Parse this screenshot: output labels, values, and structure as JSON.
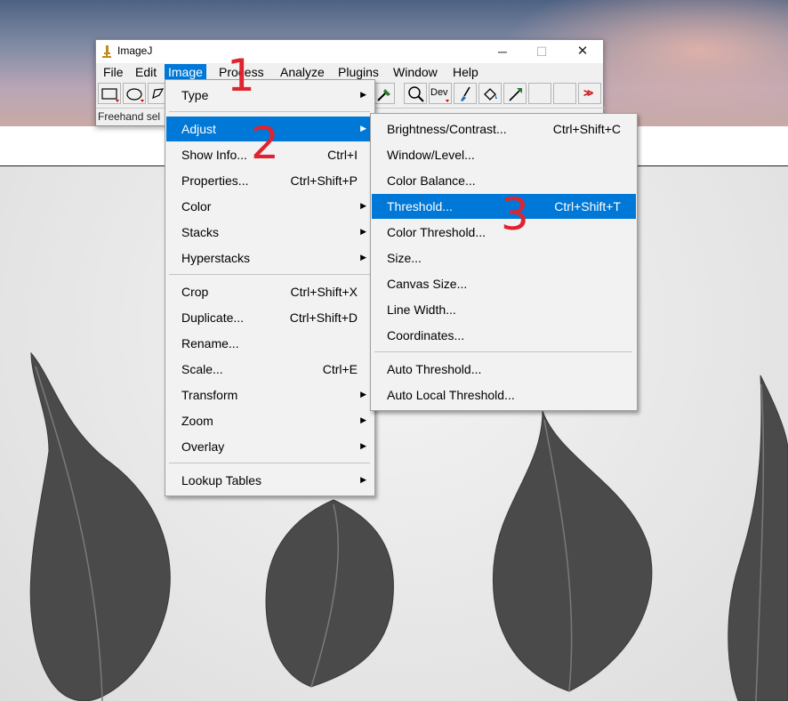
{
  "window": {
    "title": "ImageJ",
    "controls": {
      "minimize": "─",
      "maximize": "☐",
      "close": "✕"
    }
  },
  "menubar": [
    "File",
    "Edit",
    "Image",
    "Process",
    "Analyze",
    "Plugins",
    "Window",
    "Help"
  ],
  "toolbar": {
    "dev_label": "Dev",
    "more_label": "≫",
    "tools": [
      "rectangle-tool",
      "oval-tool",
      "polygon-tool",
      "color-picker-tool",
      "magnifier-tool",
      "dev-tool",
      "brush-tool",
      "flood-fill-tool",
      "arrow-tool",
      "empty-slot",
      "empty-slot",
      "more-tools"
    ]
  },
  "status": "Freehand sel",
  "image_menu": {
    "items": [
      {
        "label": "Type",
        "shortcut": "",
        "submenu": true
      },
      {
        "label": "Adjust",
        "shortcut": "",
        "submenu": true
      },
      {
        "label": "Show Info...",
        "shortcut": "Ctrl+I",
        "submenu": false
      },
      {
        "label": "Properties...",
        "shortcut": "Ctrl+Shift+P",
        "submenu": false
      },
      {
        "label": "Color",
        "shortcut": "",
        "submenu": true
      },
      {
        "label": "Stacks",
        "shortcut": "",
        "submenu": true
      },
      {
        "label": "Hyperstacks",
        "shortcut": "",
        "submenu": true
      },
      {
        "label": "Crop",
        "shortcut": "Ctrl+Shift+X",
        "submenu": false
      },
      {
        "label": "Duplicate...",
        "shortcut": "Ctrl+Shift+D",
        "submenu": false
      },
      {
        "label": "Rename...",
        "shortcut": "",
        "submenu": false
      },
      {
        "label": "Scale...",
        "shortcut": "Ctrl+E",
        "submenu": false
      },
      {
        "label": "Transform",
        "shortcut": "",
        "submenu": true
      },
      {
        "label": "Zoom",
        "shortcut": "",
        "submenu": true
      },
      {
        "label": "Overlay",
        "shortcut": "",
        "submenu": true
      },
      {
        "label": "Lookup Tables",
        "shortcut": "",
        "submenu": true
      }
    ]
  },
  "adjust_menu": {
    "items": [
      {
        "label": "Brightness/Contrast...",
        "shortcut": "Ctrl+Shift+C"
      },
      {
        "label": "Window/Level...",
        "shortcut": ""
      },
      {
        "label": "Color Balance...",
        "shortcut": ""
      },
      {
        "label": "Threshold...",
        "shortcut": "Ctrl+Shift+T"
      },
      {
        "label": "Color Threshold...",
        "shortcut": ""
      },
      {
        "label": "Size...",
        "shortcut": ""
      },
      {
        "label": "Canvas Size...",
        "shortcut": ""
      },
      {
        "label": "Line Width...",
        "shortcut": ""
      },
      {
        "label": "Coordinates...",
        "shortcut": ""
      },
      {
        "label": "Auto Threshold...",
        "shortcut": ""
      },
      {
        "label": "Auto Local Threshold...",
        "shortcut": ""
      }
    ]
  },
  "annotations": [
    "1",
    "2",
    "3"
  ],
  "colors": {
    "highlight": "#0078d7",
    "annotation": "#e0242f",
    "leaf": "#4a4a4a"
  }
}
